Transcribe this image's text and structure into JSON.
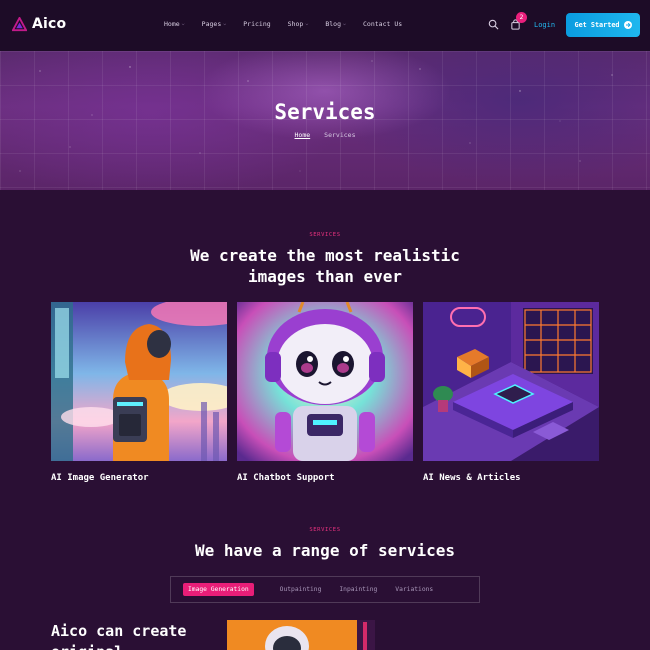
{
  "header": {
    "logo_text": "Aico",
    "nav": [
      {
        "label": "Home",
        "has_dropdown": true
      },
      {
        "label": "Pages",
        "has_dropdown": true
      },
      {
        "label": "Pricing",
        "has_dropdown": false
      },
      {
        "label": "Shop",
        "has_dropdown": true
      },
      {
        "label": "Blog",
        "has_dropdown": true
      },
      {
        "label": "Contact Us",
        "has_dropdown": false
      }
    ],
    "cart_count": "2",
    "login_label": "Login",
    "cta_label": "Get Started",
    "icons": {
      "search": "search-icon",
      "cart": "shopping-bag-icon",
      "cta": "arrow-right-icon"
    }
  },
  "hero": {
    "title": "Services",
    "breadcrumb": {
      "home": "Home",
      "current": "Services"
    }
  },
  "section_services": {
    "eyebrow": "SERVICES",
    "title_line1": "We create the most realistic",
    "title_line2": "images than ever",
    "cards": [
      {
        "label": "AI Image Generator"
      },
      {
        "label": "AI Chatbot Support"
      },
      {
        "label": "AI News & Articles"
      }
    ]
  },
  "section_range": {
    "eyebrow": "SERVICES",
    "title": "We have a range of services",
    "tabs": [
      {
        "label": "Image Generation",
        "active": true
      },
      {
        "label": "Outpainting",
        "active": false
      },
      {
        "label": "Inpainting",
        "active": false
      },
      {
        "label": "Variations",
        "active": false
      }
    ],
    "content_title_line1": "Aico can create",
    "content_title_line2": "original"
  },
  "colors": {
    "background": "#2a0f34",
    "header_bg": "#1d0c27",
    "accent_pink": "#e91e78",
    "accent_blue": "#1fb7ee"
  }
}
